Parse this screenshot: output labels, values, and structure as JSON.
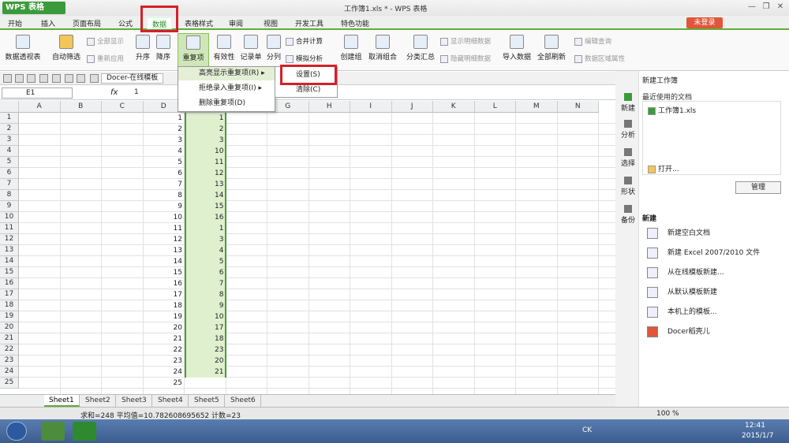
{
  "app": {
    "logo": "WPS 表格",
    "window_title": "工作簿1.xls * - WPS 表格",
    "login": "未登录"
  },
  "menus": [
    "开始",
    "插入",
    "页面布局",
    "公式",
    "数据",
    "表格样式",
    "审阅",
    "视图",
    "开发工具",
    "特色功能"
  ],
  "ribbon": {
    "pivot": "数据透视表",
    "autofilter": "自动筛选",
    "show_all": "全部显示",
    "reapply": "重新应用",
    "sort_asc": "升序",
    "sort_desc": "降序",
    "dup": "重复项",
    "valid": "有效性",
    "record": "记录单",
    "split": "分列",
    "consolidate": "合并计算",
    "whatif": "模拟分析",
    "group": "创建组",
    "ungroup": "取消组合",
    "subtotal": "分类汇总",
    "show_detail": "显示明细数据",
    "hide_detail": "隐藏明细数据",
    "import": "导入数据",
    "refresh_all": "全部刷新",
    "edit_query": "编辑查询",
    "range_prop": "数据区域属性"
  },
  "toolbar": {
    "docer": "Docer-在线模板"
  },
  "formula": {
    "namebox": "E1",
    "fx": "fx",
    "value": "1"
  },
  "columns": [
    "A",
    "B",
    "C",
    "D",
    "E",
    "F",
    "G",
    "H",
    "I",
    "J",
    "K",
    "L",
    "M",
    "N"
  ],
  "colD": [
    1,
    2,
    3,
    4,
    5,
    6,
    7,
    8,
    9,
    10,
    11,
    12,
    13,
    14,
    15,
    16,
    17,
    18,
    19,
    20,
    21,
    22,
    23,
    24,
    25
  ],
  "colE": [
    1,
    2,
    3,
    10,
    11,
    12,
    13,
    14,
    15,
    16,
    1,
    3,
    4,
    5,
    6,
    7,
    8,
    9,
    10,
    17,
    18,
    23,
    20,
    21
  ],
  "dropdown": {
    "items": [
      "高亮显示重复项(R)",
      "拒绝录入重复项(I)",
      "删除重复项(D)"
    ],
    "sub": [
      "设置(S)",
      "清除(C)"
    ]
  },
  "sheets": [
    "Sheet1",
    "Sheet2",
    "Sheet3",
    "Sheet4",
    "Sheet5",
    "Sheet6"
  ],
  "status": {
    "text": "求和=248  平均值=10.782608695652  计数=23",
    "zoom": "100 %"
  },
  "pane": {
    "title": "新建工作簿",
    "recent": "最近使用的文档",
    "file": "工作簿1.xls",
    "open": "打开...",
    "manage": "管理",
    "new": "新建",
    "tabs": [
      "新建",
      "分析",
      "选择",
      "形状",
      "备份"
    ],
    "items": [
      "新建空白文档",
      "新建 Excel 2007/2010 文件",
      "从在线模板新建...",
      "从默认模板新建",
      "本机上的模板...",
      "Docer稻壳儿"
    ]
  },
  "taskbar": {
    "ime": "CK",
    "time": "12:41",
    "date": "2015/1/7"
  }
}
